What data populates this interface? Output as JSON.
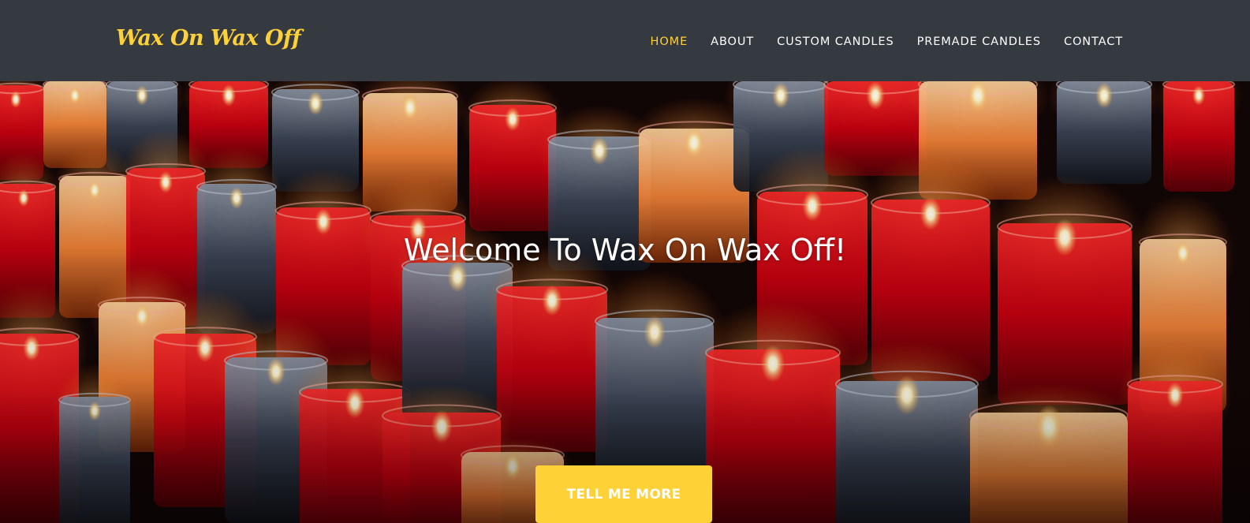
{
  "brand": {
    "name": "Wax On Wax Off"
  },
  "nav": {
    "items": [
      {
        "label": "HOME",
        "active": true
      },
      {
        "label": "ABOUT"
      },
      {
        "label": "CUSTOM CANDLES"
      },
      {
        "label": "PREMADE CANDLES"
      },
      {
        "label": "CONTACT"
      }
    ]
  },
  "hero": {
    "title": "Welcome To Wax On Wax Off!",
    "button_label": "TELL ME MORE",
    "image": "candles-photo"
  },
  "colors": {
    "navbar_bg": "#343a40",
    "accent": "#fed136",
    "nav_text": "#ffffff"
  }
}
